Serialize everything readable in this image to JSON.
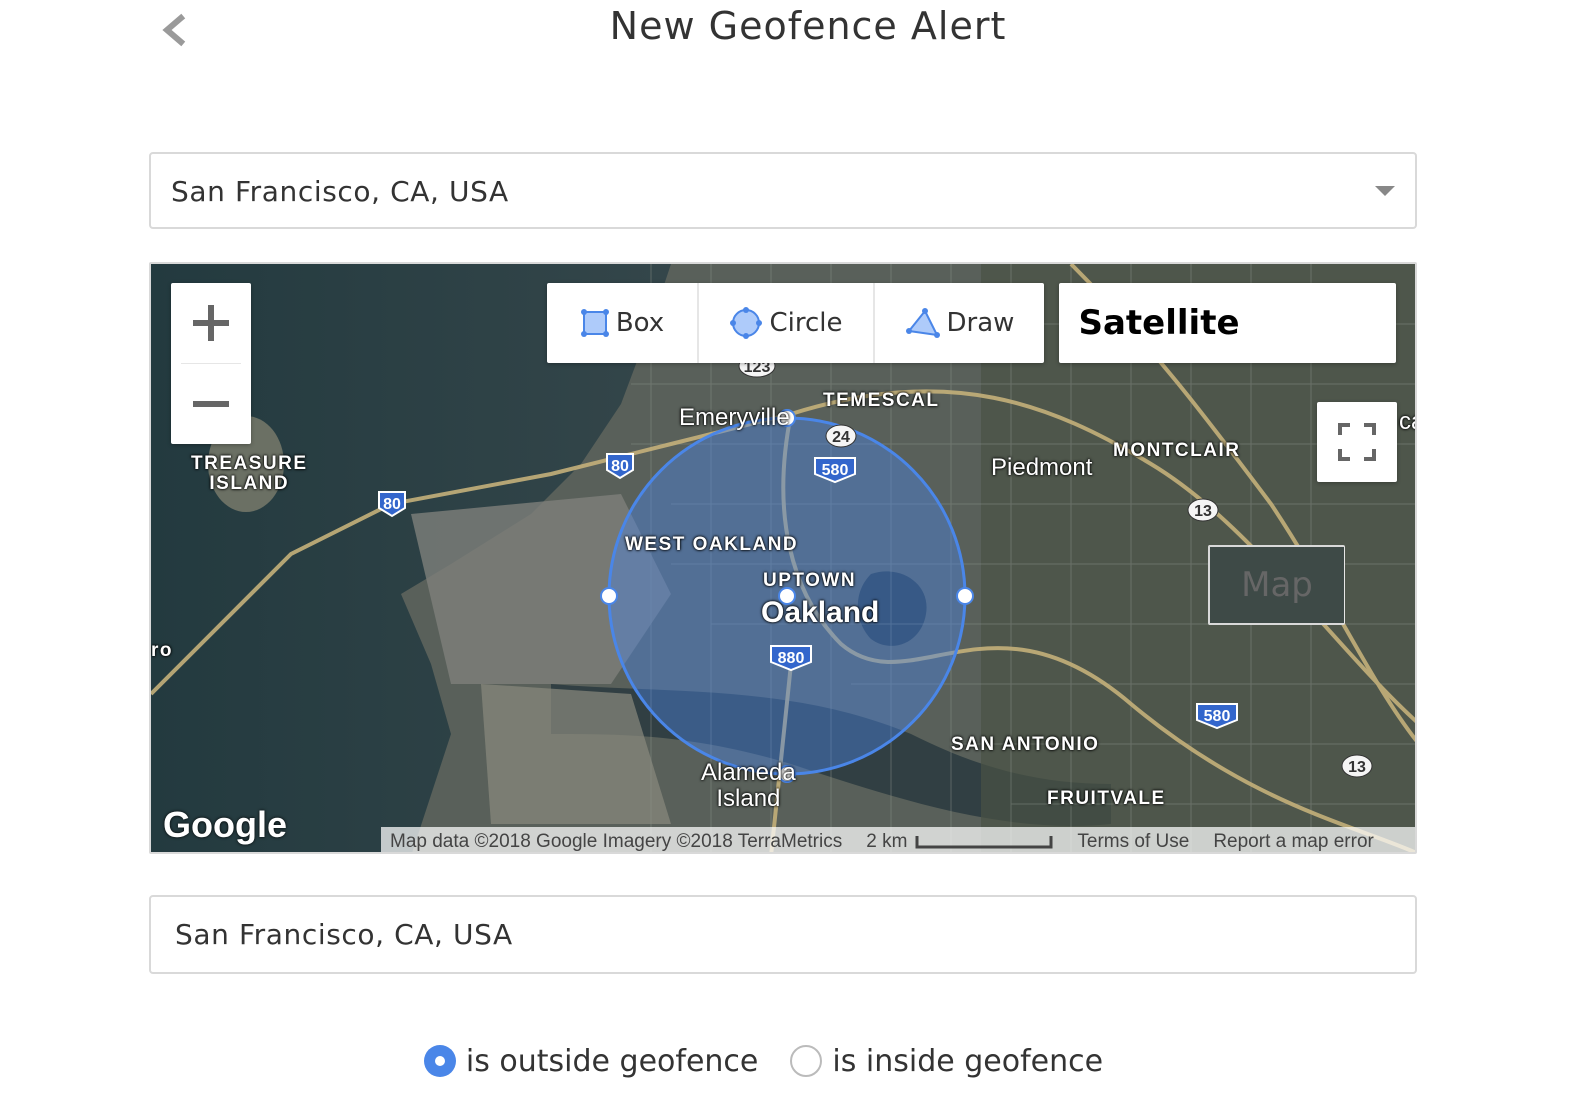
{
  "header": {
    "title": "New Geofence Alert",
    "back_icon": "chevron-left-icon"
  },
  "location_select": {
    "value": "San Francisco, CA, USA",
    "caret_icon": "caret-down-icon"
  },
  "map": {
    "draw_tools": [
      {
        "id": "box",
        "label": "Box",
        "icon": "box-select-icon"
      },
      {
        "id": "circle",
        "label": "Circle",
        "icon": "circle-select-icon"
      },
      {
        "id": "draw",
        "label": "Draw",
        "icon": "polygon-draw-icon"
      }
    ],
    "map_types": {
      "map": "Map",
      "satellite": "Satellite",
      "active": "Satellite"
    },
    "zoom_in_icon": "plus-icon",
    "zoom_out_icon": "minus-icon",
    "fullscreen_icon": "fullscreen-icon",
    "labels": {
      "treasure_island": "TREASURE\nISLAND",
      "emeryville": "Emeryville",
      "temescal": "TEMESCAL",
      "montclair": "MONTCLAIR",
      "piedmont": "Piedmont",
      "west_oakland": "WEST OAKLAND",
      "uptown": "UPTOWN",
      "oakland": "Oakland",
      "san_antonio": "SAN ANTONIO",
      "fruitvale": "FRUITVALE",
      "alameda_island": "Alameda\nIsland",
      "edge_left": "ro",
      "edge_right": "ca"
    },
    "highway_shields": [
      "80",
      "80",
      "580",
      "24",
      "123",
      "880",
      "13",
      "580",
      "13"
    ],
    "logo": "Google",
    "attribution": {
      "data": "Map data ©2018 Google Imagery ©2018 TerraMetrics",
      "scale": "2 km",
      "terms": "Terms of Use",
      "report": "Report a map error"
    },
    "geofence_color": "#4a86e8"
  },
  "location_input": {
    "value": "San Francisco, CA, USA"
  },
  "alert_condition": {
    "options": [
      {
        "label": "is outside geofence",
        "selected": true
      },
      {
        "label": "is inside geofence",
        "selected": false
      }
    ]
  },
  "colors": {
    "accent": "#4a86e8",
    "border": "#d9d9d9",
    "text": "#333333"
  }
}
